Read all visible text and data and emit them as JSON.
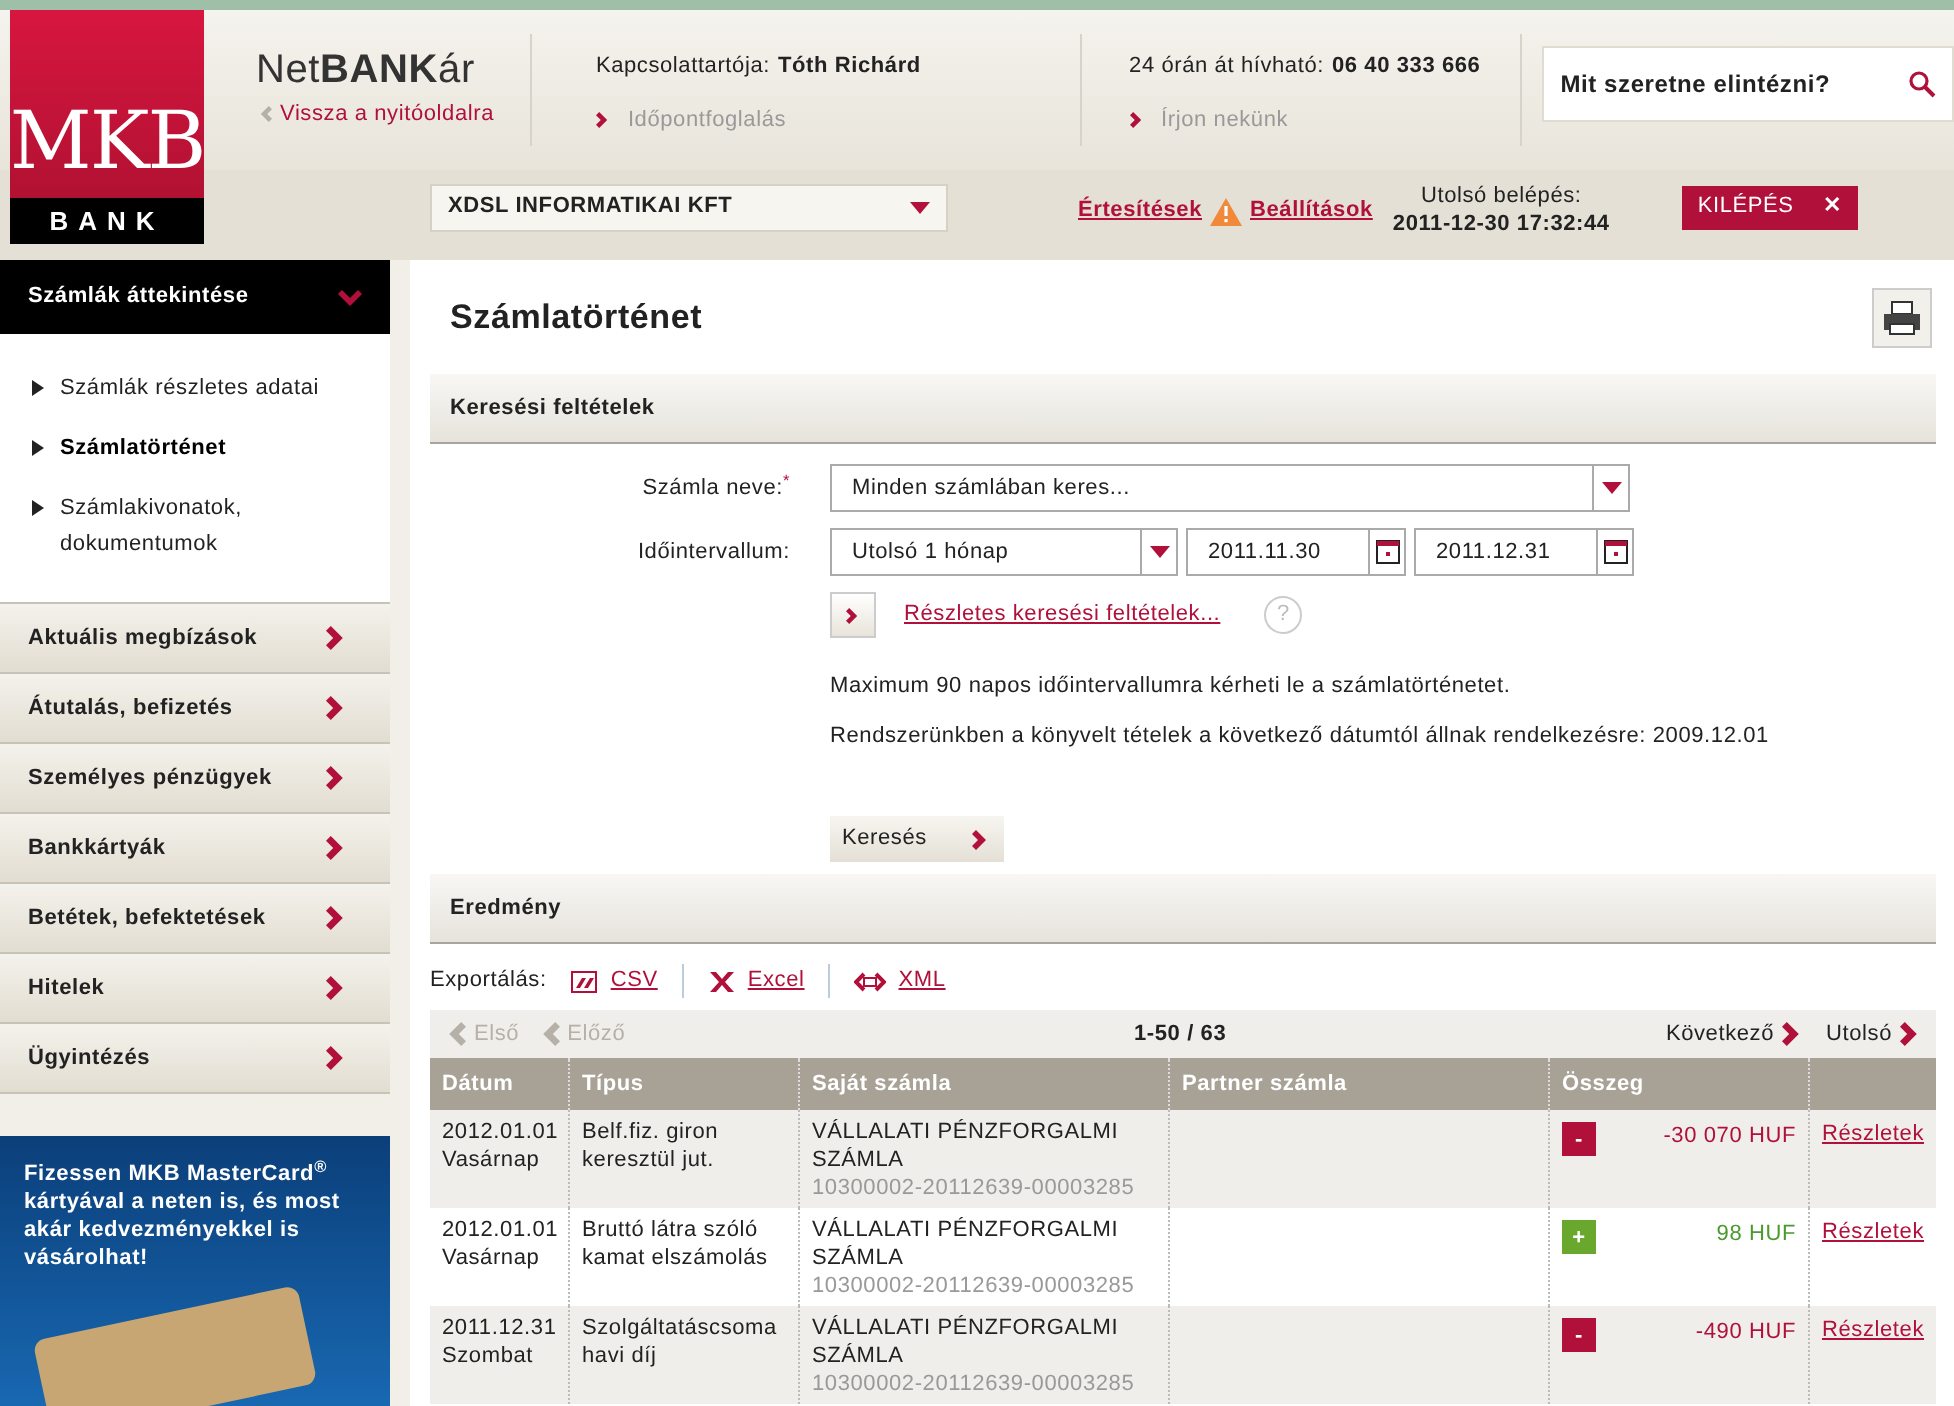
{
  "logo": {
    "top": "MKB",
    "bottom": "BANK"
  },
  "header": {
    "brand": "Net**BANK**ár",
    "back_link": "Vissza a nyitóoldalra",
    "contact_label": "Kapcsolattartója:",
    "contact_name": "Tóth Richárd",
    "appointment_link": "Időpontfoglalás",
    "hotline_label": "24 órán át hívható:",
    "hotline_number": "06 40 333 666",
    "write_link": "Írjon nekünk",
    "search_placeholder": "Mit szeretne elintézni?"
  },
  "subheader": {
    "company": "XDSL INFORMATIKAI KFT",
    "notifications": "Értesítések",
    "settings": "Beállítások",
    "last_login_label": "Utolsó belépés:",
    "last_login": "2011-12-30 17:32:44",
    "logout": "KILÉPÉS",
    "logout_icon": "✕"
  },
  "sidebar": {
    "section": "Számlák áttekintése",
    "expanded": true,
    "subitems": [
      {
        "label": "Számlák részletes adatai",
        "selected": false
      },
      {
        "label": "Számlatörténet",
        "selected": true
      },
      {
        "label": "Számlakivonatok, dokumentumok",
        "selected": false
      }
    ],
    "items": [
      "Aktuális megbízások",
      "Átutalás, befizetés",
      "Személyes pénzügyek",
      "Bankkártyák",
      "Betétek, befektetések",
      "Hitelek",
      "Ügyintézés"
    ],
    "ad": "Fizessen MKB MasterCard$^{®}$ kártyával a neten is, és most akár kedvezményekkel is vásárolhat!"
  },
  "page": {
    "title": "Számlatörténet",
    "search_section": "Keresési feltételek",
    "account_label": "Számla neve:",
    "required_mark": "*",
    "account_value": "Minden számlában keres...",
    "interval_label": "Időintervallum:",
    "interval_value": "Utolsó 1 hónap",
    "date_from": "2011.11.30",
    "date_to": "2011.12.31",
    "advanced_link": "Részletes keresési feltételek...",
    "help_icon": "?",
    "notes": [
      "Maximum 90 napos időintervallumra kérheti le a számlatörténetet.",
      "Rendszerünkben a könyvelt tételek a következő dátumtól állnak rendelkezésre: 2009.12.01"
    ],
    "search_button": "Keresés",
    "results_section": "Eredmény",
    "export_label": "Exportálás:",
    "exports": [
      {
        "kind": "csv",
        "label": "CSV"
      },
      {
        "kind": "excel",
        "label": "Excel"
      },
      {
        "kind": "xml",
        "label": "XML"
      }
    ],
    "pager": {
      "first": "Első",
      "prev": "Előző",
      "range": "1-50 / 63",
      "next": "Következő",
      "last": "Utolsó",
      "first_disabled": true
    },
    "table": {
      "columns": [
        "Dátum",
        "Típus",
        "Saját számla",
        "Partner számla",
        "Összeg"
      ],
      "rows": [
        {
          "date": "2012.01.01",
          "day": "Vasárnap",
          "type": "Belf.fiz. giron keresztül jut.",
          "account": "VÁLLALATI PÉNZFORGALMI SZÁMLA",
          "account_number": "10300002-20112639-00003285",
          "kind": "debit",
          "sign": "-",
          "amount": "-30 070 HUF",
          "details": "Részletek"
        },
        {
          "date": "2012.01.01",
          "day": "Vasárnap",
          "type": "Bruttó látra szóló kamat elszámolás",
          "account": "VÁLLALATI PÉNZFORGALMI SZÁMLA",
          "account_number": "10300002-20112639-00003285",
          "kind": "credit",
          "sign": "+",
          "amount": "98 HUF",
          "details": "Részletek"
        },
        {
          "date": "2011.12.31",
          "day": "Szombat",
          "type": "Szolgáltatáscsoma havi díj",
          "account": "VÁLLALATI PÉNZFORGALMI SZÁMLA",
          "account_number": "10300002-20112639-00003285",
          "kind": "debit",
          "sign": "-",
          "amount": "-490 HUF",
          "details": "Részletek"
        }
      ]
    }
  }
}
